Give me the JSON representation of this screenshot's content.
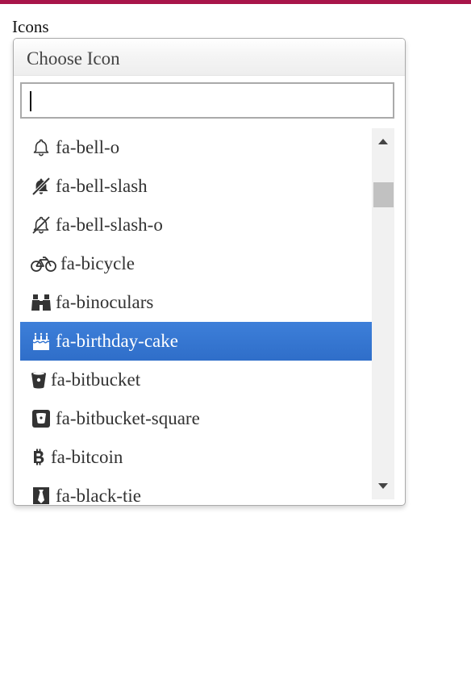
{
  "label": "Icons",
  "select": {
    "placeholder": "Choose Icon",
    "search_value": ""
  },
  "results": [
    {
      "label": "fa-bell-o",
      "icon": "bell-o-icon",
      "highlighted": false
    },
    {
      "label": "fa-bell-slash",
      "icon": "bell-slash-icon",
      "highlighted": false
    },
    {
      "label": "fa-bell-slash-o",
      "icon": "bell-slash-o-icon",
      "highlighted": false
    },
    {
      "label": "fa-bicycle",
      "icon": "bicycle-icon",
      "highlighted": false
    },
    {
      "label": "fa-binoculars",
      "icon": "binoculars-icon",
      "highlighted": false
    },
    {
      "label": "fa-birthday-cake",
      "icon": "birthday-cake-icon",
      "highlighted": true
    },
    {
      "label": "fa-bitbucket",
      "icon": "bitbucket-icon",
      "highlighted": false
    },
    {
      "label": "fa-bitbucket-square",
      "icon": "bitbucket-square-icon",
      "highlighted": false
    },
    {
      "label": "fa-bitcoin",
      "icon": "bitcoin-icon",
      "highlighted": false
    },
    {
      "label": "fa-black-tie",
      "icon": "black-tie-icon",
      "highlighted": false
    }
  ],
  "colors": {
    "top_bar": "#a8154a",
    "highlight": "#3476d2"
  }
}
